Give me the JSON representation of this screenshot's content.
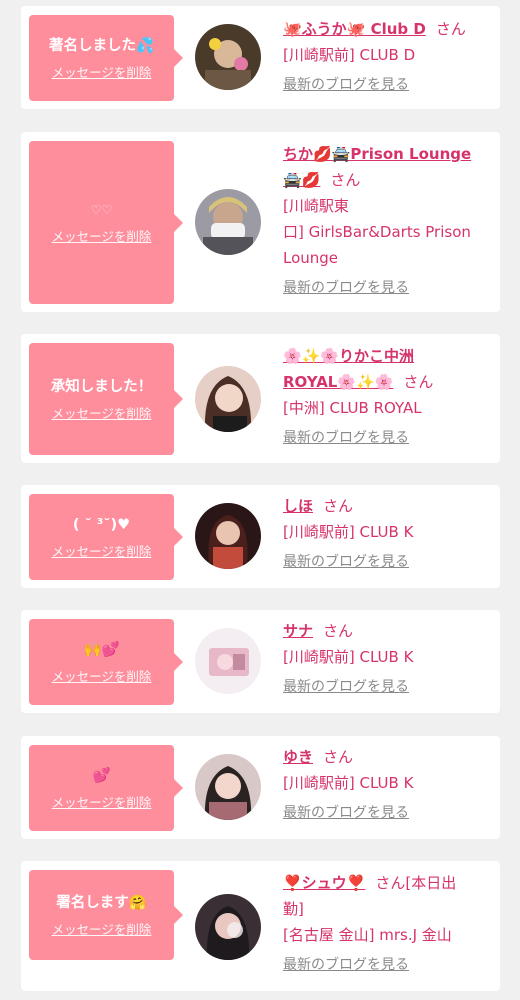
{
  "cards": [
    {
      "bubble_text": "著名しました💦",
      "delete_label": "メッセージを削除",
      "name": "🐙ふうか🐙 Club D",
      "san": "さん",
      "shop": "[川崎駅前] CLUB D",
      "blog_label": "最新のブログを見る",
      "avatar_color": "#5a4632"
    },
    {
      "bubble_text": "♡♡",
      "delete_label": "メッセージを削除",
      "name": "ちか💋🚔Prison Lounge",
      "name2": "🚔💋",
      "san": "さん",
      "shop": "[川崎駅東",
      "shop2": "口] GirlsBar&Darts Prison",
      "shop3": "Lounge",
      "blog_label": "最新のブログを見る",
      "avatar_color": "#8d8c93"
    },
    {
      "bubble_text": "承知しました！",
      "delete_label": "メッセージを削除",
      "name": "🌸✨🌸りかこ中洲",
      "name2": "ROYAL🌸✨🌸",
      "san": "さん",
      "shop": "[中洲] CLUB ROYAL",
      "blog_label": "最新のブログを見る",
      "avatar_color": "#d7b2a2"
    },
    {
      "bubble_text": "( ˘ ³˘)♥",
      "delete_label": "メッセージを削除",
      "name": "しほ",
      "san": "さん",
      "shop": "[川崎駅前] CLUB K",
      "blog_label": "最新のブログを見る",
      "avatar_color": "#3b1e1c"
    },
    {
      "bubble_text": "🙌💕",
      "delete_label": "メッセージを削除",
      "name": "サナ",
      "san": "さん",
      "shop": "[川崎駅前] CLUB K",
      "blog_label": "最新のブログを見る",
      "avatar_color": "#e8cfd6"
    },
    {
      "bubble_text": "💕",
      "delete_label": "メッセージを削除",
      "name": "ゆき",
      "san": "さん",
      "shop": "[川崎駅前] CLUB K",
      "blog_label": "最新のブログを見る",
      "avatar_color": "#c9a7a8"
    },
    {
      "bubble_text": "署名します🤗",
      "delete_label": "メッセージを削除",
      "name": "❣️シュウ❣️",
      "san": "さん[本日出",
      "name2": "勤]",
      "shop": "[名古屋 金山] mrs.J 金山",
      "blog_label": "最新のブログを見る",
      "avatar_color": "#3a2f35"
    }
  ],
  "colors": {
    "bubble": "#ff8e9d",
    "accent": "#d6336c",
    "card": "#ffffff",
    "bg": "#f0f0f0"
  }
}
